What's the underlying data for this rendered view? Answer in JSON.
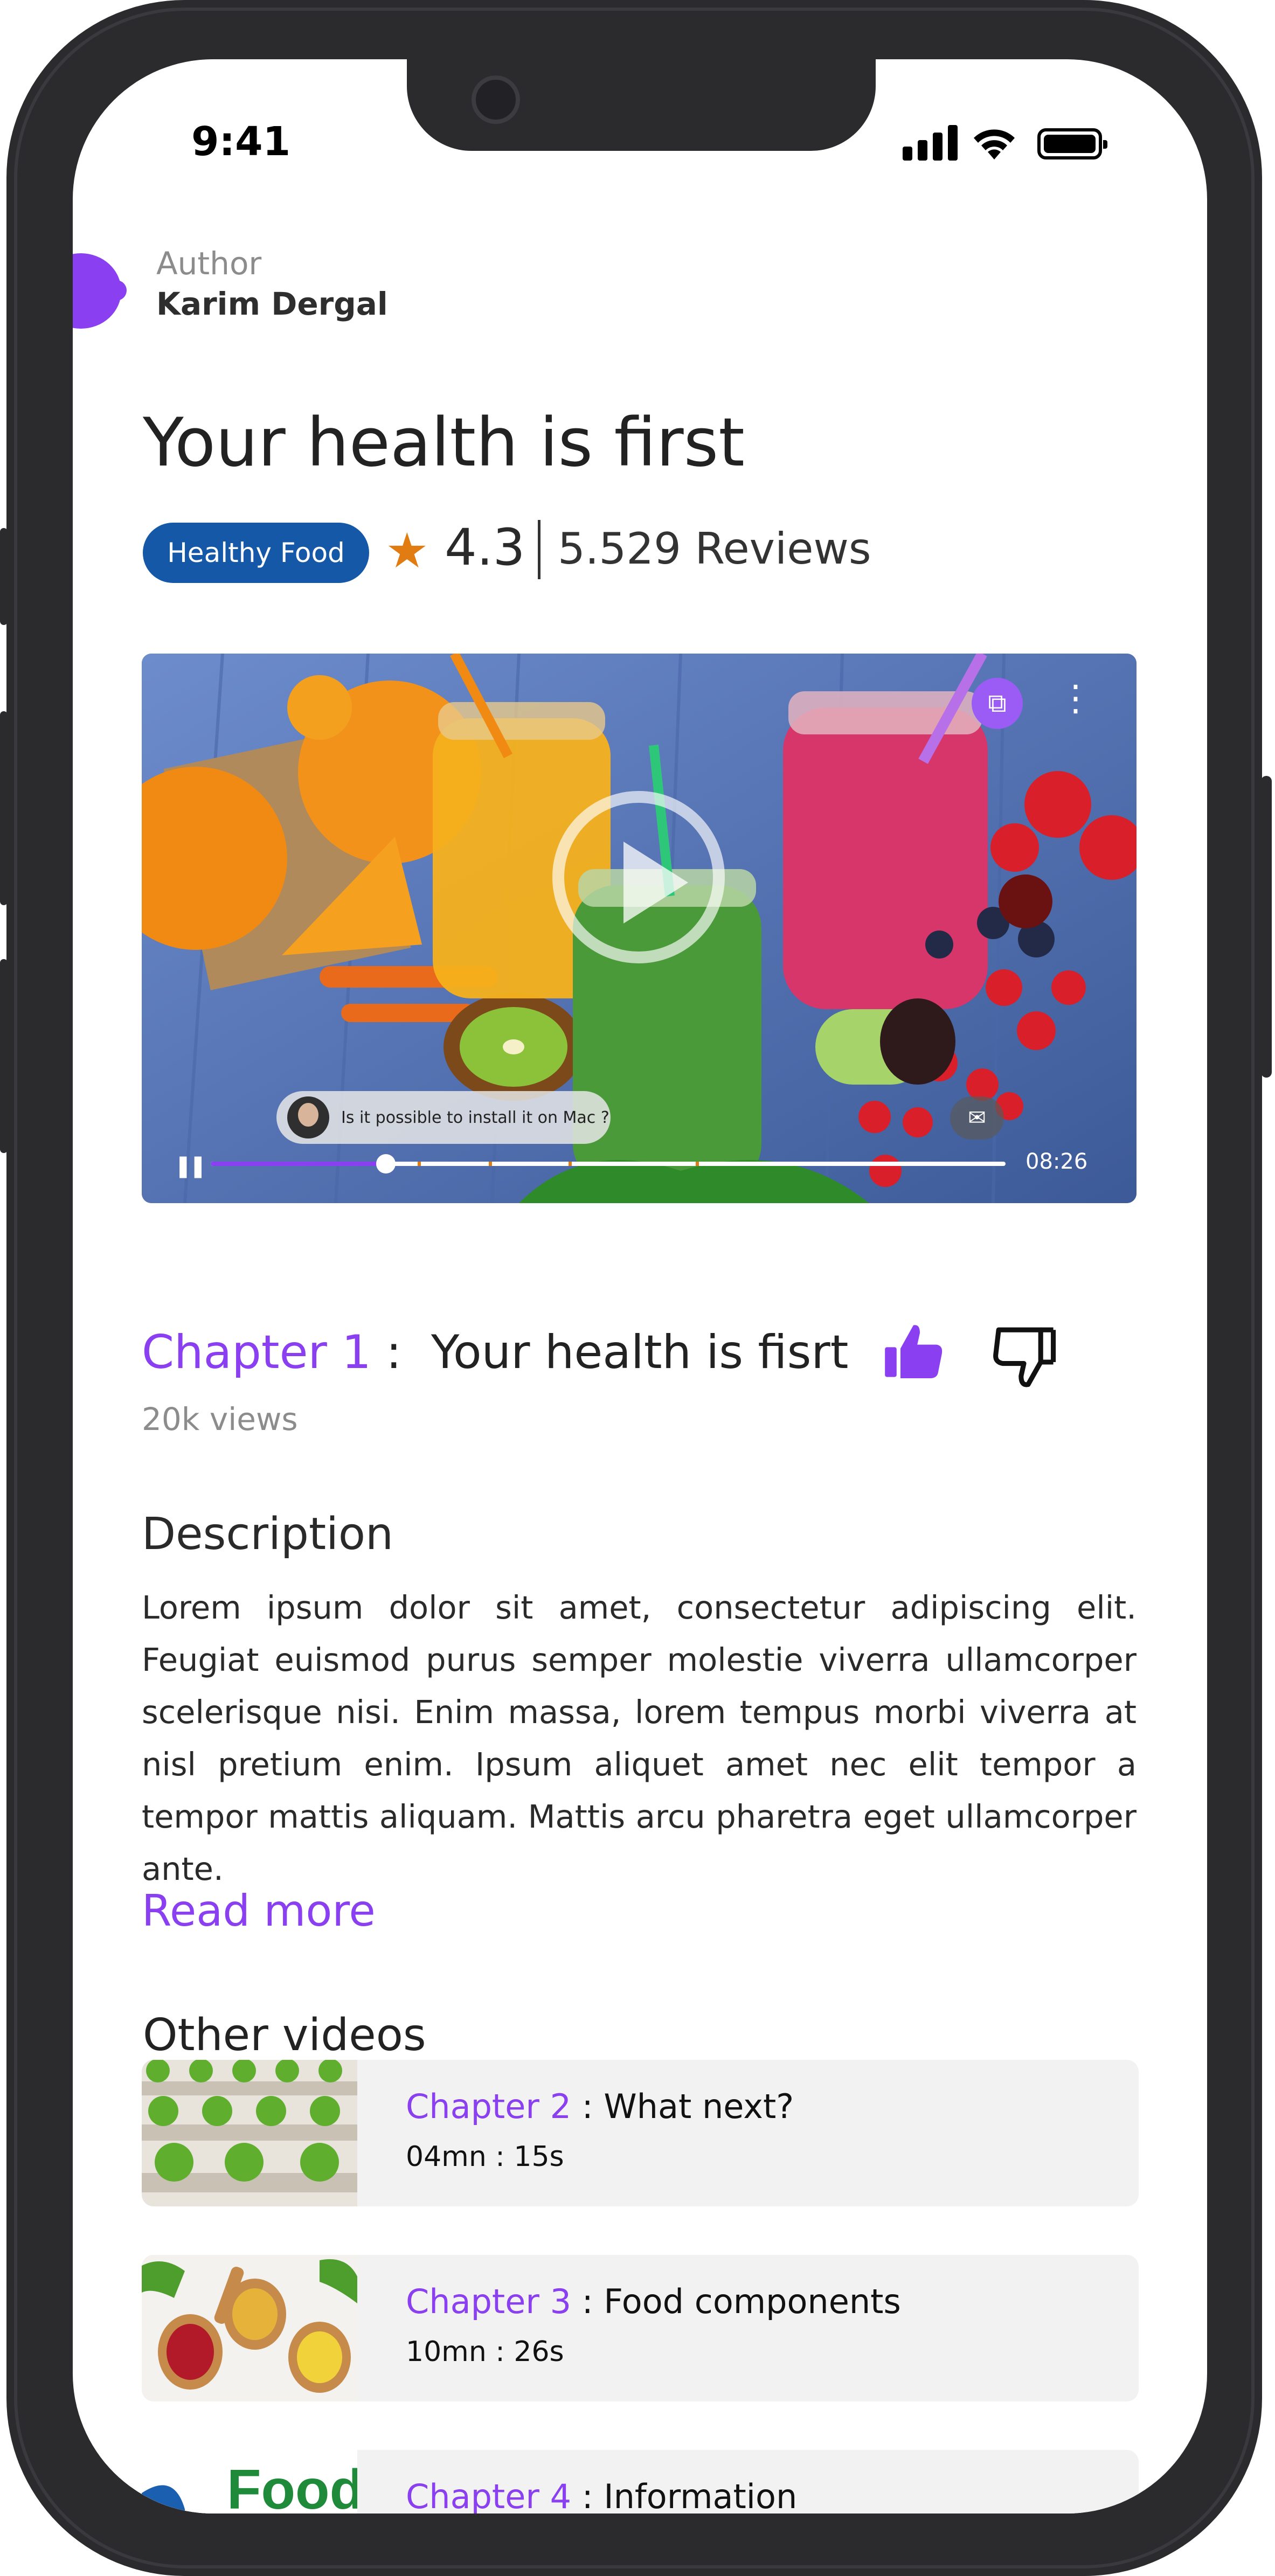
{
  "status_bar": {
    "time": "9:41"
  },
  "author": {
    "label": "Author",
    "name": "Karim Dergal"
  },
  "article": {
    "title": "Your health is first",
    "tag": "Healthy Food",
    "rating": "4.3",
    "reviews": "5.529 Reviews"
  },
  "video": {
    "comment": "Is it possible to install it on Mac ?",
    "duration": "08:26",
    "progress_fraction": 0.22,
    "chapter_markers": [
      0.26,
      0.35,
      0.45,
      0.61
    ]
  },
  "chapter": {
    "prefix": "Chapter 1",
    "separator": " :  ",
    "title": "Your health is fisrt",
    "views": "20k views"
  },
  "description": {
    "heading": "Description",
    "text": "Lorem ipsum dolor sit amet, consectetur adipiscing elit. Feugiat euismod purus semper molestie viverra ullamcorper scelerisque nisi. Enim massa, lorem tempus morbi viverra at nisl pretium enim. Ipsum aliquet amet nec elit tempor a tempor mattis aliquam. Mattis arcu pharetra eget ullamcorper ante.",
    "read_more": "Read more"
  },
  "other_videos": {
    "heading": "Other videos",
    "items": [
      {
        "prefix": "Chapter 2",
        "title": " : What next?",
        "duration": "04mn : 15s"
      },
      {
        "prefix": "Chapter 3",
        "title": " : Food components",
        "duration": "10mn : 26s"
      },
      {
        "prefix": "Chapter 4",
        "title": " : Information",
        "duration": ""
      }
    ],
    "thumb4_logo_text": "Food"
  },
  "colors": {
    "accent": "#8a3ff0",
    "tag_bg": "#1558a8",
    "star": "#e07c12",
    "card_bg": "#f2f2f2"
  }
}
